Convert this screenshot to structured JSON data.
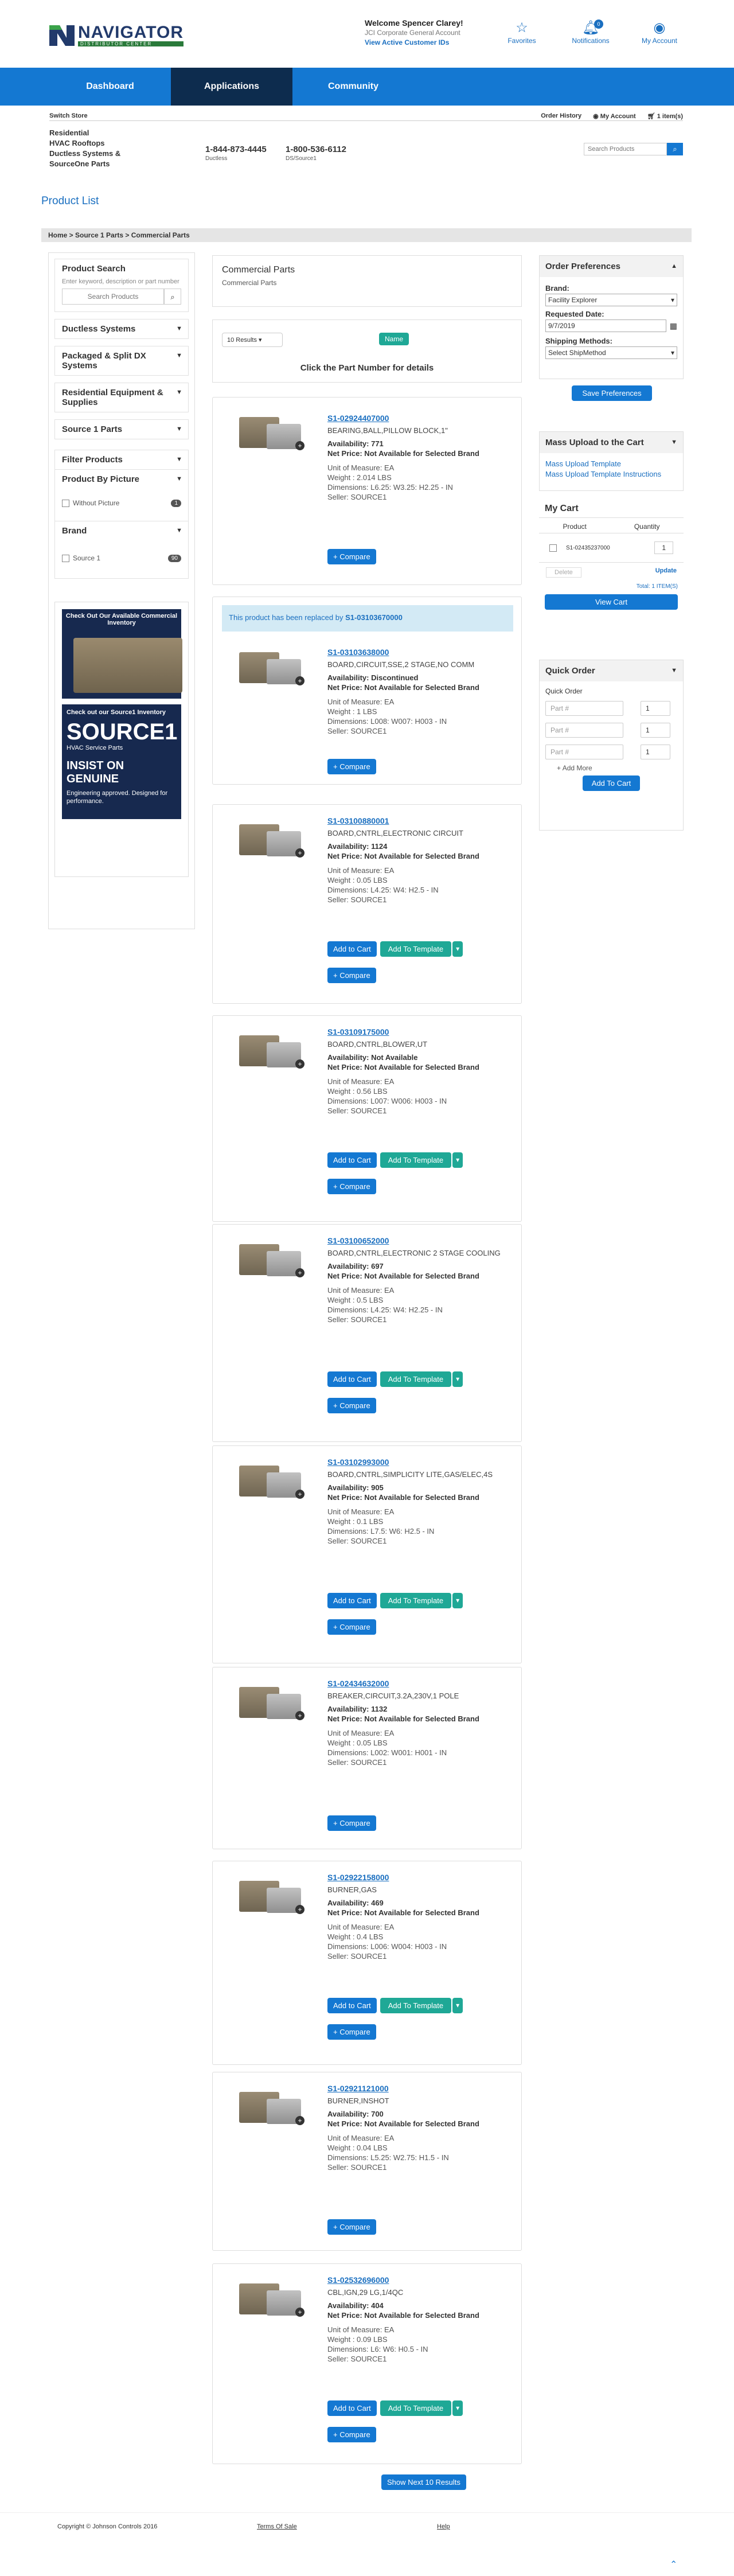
{
  "header": {
    "logo_main": "NAVIGATOR",
    "logo_tag": "DISTRIBUTOR CENTER",
    "welcome": "Welcome Spencer Clarey!",
    "company": "JCI Corporate General Account",
    "view_ids": "View Active Customer IDs",
    "favorites": "Favorites",
    "notifications": "Notifications",
    "notif_count": "0",
    "my_account": "My Account"
  },
  "nav": [
    "Dashboard",
    "Applications",
    "Community"
  ],
  "subbar": {
    "store": "Switch Store",
    "order_history": "Order History",
    "my_account": "My Account",
    "cart": "1 item(s)"
  },
  "divisions": {
    "list": [
      "Residential",
      "HVAC Rooftops",
      "Ductless Systems &",
      "SourceOne Parts"
    ],
    "phone1": "1-844-873-4445",
    "phone1_label": "Ductless",
    "phone2": "1-800-536-6112",
    "phone2_label": "DS/Source1",
    "search_placeholder": "Search Products"
  },
  "page_title": "Product List",
  "breadcrumb": "Home  >  Source 1 Parts  >  Commercial Parts",
  "left": {
    "search_title": "Product Search",
    "search_hint": "Enter keyword, description or part number",
    "search_placeholder": "Search Products",
    "categories": [
      "Ductless Systems",
      "Packaged & Split DX Systems",
      "Residential Equipment & Supplies",
      "Source 1 Parts"
    ],
    "filter_title": "Filter Products",
    "by_picture": "Product By Picture",
    "without_picture": "Without Picture",
    "without_count": "1",
    "brand_title": "Brand",
    "brand_item": "Source 1",
    "brand_count": "90",
    "ad1_text": "Check Out Our Available Commercial Inventory",
    "ad2_t1": "Check out our Source1 Inventory",
    "ad2_t2": "SOURCE1",
    "ad2_t3": "HVAC Service Parts",
    "ad2_t4": "INSIST ON GENUINE",
    "ad2_t5": "Engineering approved. Designed for performance."
  },
  "main": {
    "heading": "Commercial Parts",
    "sub": "Commercial Parts",
    "results": "10 Results",
    "sort": "Name",
    "click_hint": "Click the Part Number for details"
  },
  "products": [
    {
      "pn": "S1-02924407000",
      "desc": "BEARING,BALL,PILLOW BLOCK,1\"",
      "avail": "Availability: 771",
      "price": "Net Price: Not Available for Selected Brand",
      "uom": "Unit of Measure: EA",
      "weight": "Weight : 2.014 LBS",
      "dims": "Dimensions: L6.25: W3.25: H2.25 - IN",
      "seller": "Seller: SOURCE1"
    },
    {
      "replaced_text": "This product has been replaced by ",
      "replaced_pn": "S1-03103670000",
      "pn": "S1-03103638000",
      "desc": "BOARD,CIRCUIT,SSE,2 STAGE,NO COMM",
      "avail": "Availability: Discontinued",
      "price": "Net Price: Not Available for Selected Brand",
      "uom": "Unit of Measure: EA",
      "weight": "Weight : 1 LBS",
      "dims": "Dimensions: L008: W007: H003 - IN",
      "seller": "Seller: SOURCE1"
    },
    {
      "pn": "S1-03100880001",
      "desc": "BOARD,CNTRL,ELECTRONIC CIRCUIT",
      "avail": "Availability: 1124",
      "price": "Net Price: Not Available for Selected Brand",
      "uom": "Unit of Measure: EA",
      "weight": "Weight : 0.05 LBS",
      "dims": "Dimensions: L4.25: W4: H2.5 - IN",
      "seller": "Seller: SOURCE1"
    },
    {
      "pn": "S1-03109175000",
      "desc": "BOARD,CNTRL,BLOWER,UT",
      "avail": "Availability: Not Available",
      "price": "Net Price: Not Available for Selected Brand",
      "uom": "Unit of Measure: EA",
      "weight": "Weight : 0.56 LBS",
      "dims": "Dimensions: L007: W006: H003 - IN",
      "seller": "Seller: SOURCE1"
    },
    {
      "pn": "S1-03100652000",
      "desc": "BOARD,CNTRL,ELECTRONIC 2 STAGE COOLING",
      "avail": "Availability: 697",
      "price": "Net Price: Not Available for Selected Brand",
      "uom": "Unit of Measure: EA",
      "weight": "Weight : 0.5 LBS",
      "dims": "Dimensions: L4.25: W4: H2.25 - IN",
      "seller": "Seller: SOURCE1"
    },
    {
      "pn": "S1-03102993000",
      "desc": "BOARD,CNTRL,SIMPLICITY LITE,GAS/ELEC,4S",
      "avail": "Availability: 905",
      "price": "Net Price: Not Available for Selected Brand",
      "uom": "Unit of Measure: EA",
      "weight": "Weight : 0.1 LBS",
      "dims": "Dimensions: L7.5: W6: H2.5 - IN",
      "seller": "Seller: SOURCE1"
    },
    {
      "pn": "S1-02434632000",
      "desc": "BREAKER,CIRCUIT,3.2A,230V,1 POLE",
      "avail": "Availability: 1132",
      "price": "Net Price: Not Available for Selected Brand",
      "uom": "Unit of Measure: EA",
      "weight": "Weight : 0.05 LBS",
      "dims": "Dimensions: L002: W001: H001 - IN",
      "seller": "Seller: SOURCE1"
    },
    {
      "pn": "S1-02922158000",
      "desc": "BURNER,GAS",
      "avail": "Availability: 469",
      "price": "Net Price: Not Available for Selected Brand",
      "uom": "Unit of Measure: EA",
      "weight": "Weight : 0.4 LBS",
      "dims": "Dimensions: L006: W004: H003 - IN",
      "seller": "Seller: SOURCE1"
    },
    {
      "pn": "S1-02921121000",
      "desc": "BURNER,INSHOT",
      "avail": "Availability: 700",
      "price": "Net Price: Not Available for Selected Brand",
      "uom": "Unit of Measure: EA",
      "weight": "Weight : 0.04 LBS",
      "dims": "Dimensions: L5.25: W2.75: H1.5 - IN",
      "seller": "Seller: SOURCE1"
    },
    {
      "pn": "S1-02532696000",
      "desc": "CBL,IGN,29 LG,1/4QC",
      "avail": "Availability: 404",
      "price": "Net Price: Not Available for Selected Brand",
      "uom": "Unit of Measure: EA",
      "weight": "Weight : 0.09 LBS",
      "dims": "Dimensions: L6: W6: H0.5 - IN",
      "seller": "Seller: SOURCE1"
    }
  ],
  "buttons": {
    "add_to_cart": "Add to Cart",
    "add_to_template": "Add To Template",
    "compare": "+ Compare",
    "show_next": "Show Next 10 Results"
  },
  "right": {
    "prefs_title": "Order Preferences",
    "brand_label": "Brand:",
    "brand_value": "Facility Explorer",
    "date_label": "Requested Date:",
    "date_value": "9/7/2019",
    "ship_label": "Shipping Methods:",
    "ship_value": "Select ShipMethod",
    "save": "Save Preferences",
    "mass_title": "Mass Upload to the Cart",
    "mass_link1": "Mass Upload Template",
    "mass_link2": "Mass Upload Template Instructions",
    "cart_title": "My Cart",
    "col_product": "Product",
    "col_qty": "Quantity",
    "cart_item": "S1-02435237000",
    "cart_qty": "1",
    "delete": "Delete",
    "update": "Update",
    "total": "Total: 1 ITEM(S)",
    "view_cart": "View Cart",
    "quick_title": "Quick Order",
    "quick_sub": "Quick Order",
    "part_placeholder": "Part #",
    "qty_default": "1",
    "add_more": "Add More",
    "add_to_cart": "Add To Cart"
  },
  "footer": {
    "copy": "Copyright © Johnson Controls 2016",
    "terms": "Terms Of Sale",
    "help": "Help"
  },
  "colors": {
    "brand": "#1478d2",
    "nav_active": "#0d2c4e",
    "teal": "#1fa896"
  }
}
